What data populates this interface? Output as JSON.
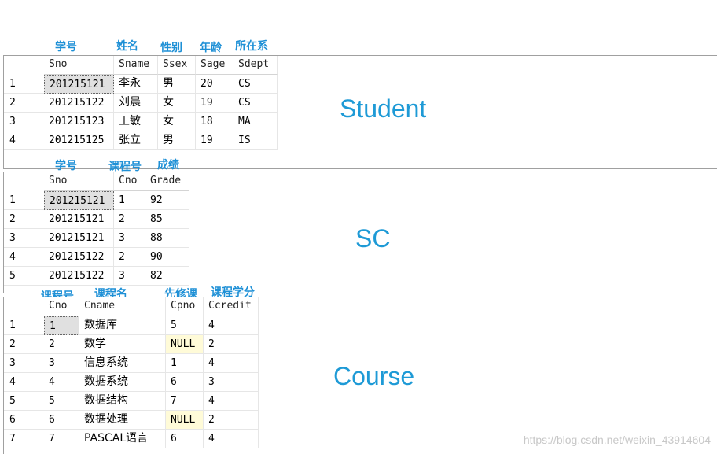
{
  "student": {
    "caption": "Student",
    "annotations": [
      "学号",
      "姓名",
      "性别",
      "年龄",
      "所在系"
    ],
    "columns": [
      "Sno",
      "Sname",
      "Ssex",
      "Sage",
      "Sdept"
    ],
    "rows": [
      [
        "1",
        "201215121",
        "李永",
        "男",
        "20",
        "CS"
      ],
      [
        "2",
        "201215122",
        "刘晨",
        "女",
        "19",
        "CS"
      ],
      [
        "3",
        "201215123",
        "王敏",
        "女",
        "18",
        "MA"
      ],
      [
        "4",
        "201215125",
        "张立",
        "男",
        "19",
        "IS"
      ]
    ]
  },
  "sc": {
    "caption": "SC",
    "annotations": [
      "学号",
      "课程号",
      "成绩"
    ],
    "columns": [
      "Sno",
      "Cno",
      "Grade"
    ],
    "rows": [
      [
        "1",
        "201215121",
        "1",
        "92"
      ],
      [
        "2",
        "201215121",
        "2",
        "85"
      ],
      [
        "3",
        "201215121",
        "3",
        "88"
      ],
      [
        "4",
        "201215122",
        "2",
        "90"
      ],
      [
        "5",
        "201215122",
        "3",
        "82"
      ]
    ]
  },
  "course": {
    "caption": "Course",
    "annotations": [
      "课程号",
      "课程名",
      "先修课",
      "课程学分"
    ],
    "columns": [
      "Cno",
      "Cname",
      "Cpno",
      "Ccredit"
    ],
    "rows": [
      [
        "1",
        "1",
        "数据库",
        "5",
        "4"
      ],
      [
        "2",
        "2",
        "数学",
        "NULL",
        "2"
      ],
      [
        "3",
        "3",
        "信息系统",
        "1",
        "4"
      ],
      [
        "4",
        "4",
        "数据系统",
        "6",
        "3"
      ],
      [
        "5",
        "5",
        "数据结构",
        "7",
        "4"
      ],
      [
        "6",
        "6",
        "数据处理",
        "NULL",
        "2"
      ],
      [
        "7",
        "7",
        "PASCAL语言",
        "6",
        "4"
      ]
    ]
  },
  "watermark": "https://blog.csdn.net/weixin_43914604"
}
